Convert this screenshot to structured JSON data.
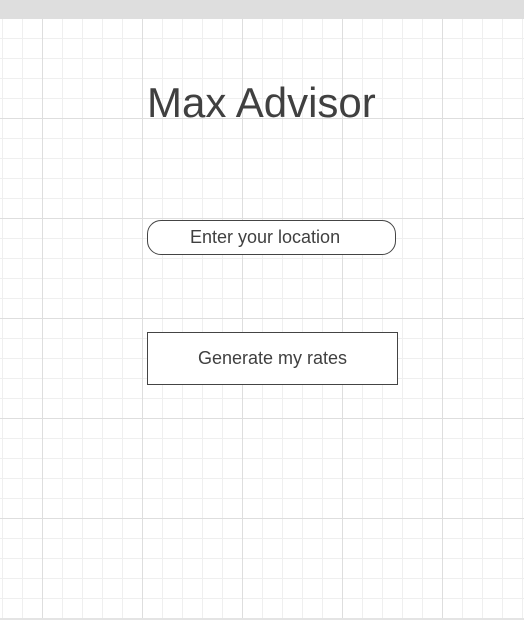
{
  "app": {
    "title": "Max Advisor"
  },
  "form": {
    "location_placeholder": "Enter your location",
    "location_value": "",
    "generate_label": "Generate my rates"
  },
  "colors": {
    "text": "#404040",
    "border": "#444444",
    "grid_major": "#dedede",
    "grid_minor": "#efefef",
    "top_bar": "#dedede"
  }
}
